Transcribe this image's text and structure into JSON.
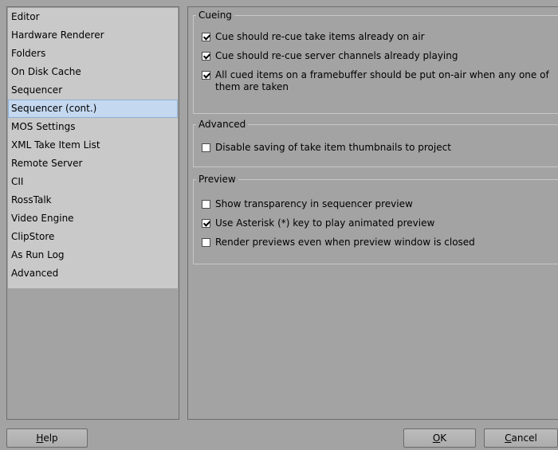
{
  "sidebar": {
    "items": [
      {
        "label": "Editor"
      },
      {
        "label": "Hardware Renderer"
      },
      {
        "label": "Folders"
      },
      {
        "label": "On Disk Cache"
      },
      {
        "label": "Sequencer"
      },
      {
        "label": "Sequencer (cont.)",
        "selected": true
      },
      {
        "label": "MOS Settings"
      },
      {
        "label": "XML Take Item List"
      },
      {
        "label": "Remote Server"
      },
      {
        "label": "CII"
      },
      {
        "label": "RossTalk"
      },
      {
        "label": "Video Engine"
      },
      {
        "label": "ClipStore"
      },
      {
        "label": "As Run Log"
      },
      {
        "label": "Advanced"
      }
    ]
  },
  "groups": {
    "cueing": {
      "title": "Cueing",
      "options": [
        {
          "label": "Cue should re-cue take items already on air",
          "checked": true
        },
        {
          "label": "Cue should re-cue server channels already playing",
          "checked": true
        },
        {
          "label": "All cued items on a framebuffer should be put on-air when any one of them are taken",
          "checked": true
        }
      ]
    },
    "advanced": {
      "title": "Advanced",
      "options": [
        {
          "label": "Disable saving of take item thumbnails to project",
          "checked": false
        }
      ]
    },
    "preview": {
      "title": "Preview",
      "options": [
        {
          "label": "Show transparency in sequencer preview",
          "checked": false
        },
        {
          "label": "Use Asterisk (*) key to play animated preview",
          "checked": true
        },
        {
          "label": "Render previews even when preview window is closed",
          "checked": false
        }
      ]
    }
  },
  "buttons": {
    "help": {
      "mnemonic": "H",
      "rest": "elp"
    },
    "ok": {
      "mnemonic": "O",
      "rest": "K"
    },
    "cancel": {
      "mnemonic": "C",
      "rest": "ancel"
    }
  }
}
